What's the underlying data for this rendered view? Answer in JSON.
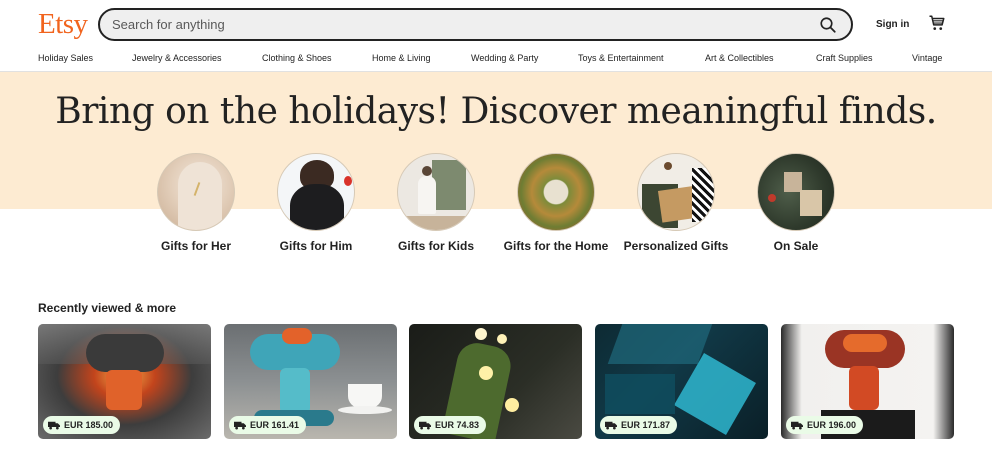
{
  "header": {
    "logo": "Etsy",
    "search_placeholder": "Search for anything",
    "sign_in": "Sign in",
    "brand_color": "#F1641E"
  },
  "nav": {
    "items": [
      {
        "label": "Holiday Sales"
      },
      {
        "label": "Jewelry & Accessories"
      },
      {
        "label": "Clothing & Shoes"
      },
      {
        "label": "Home & Living"
      },
      {
        "label": "Wedding & Party"
      },
      {
        "label": "Toys & Entertainment"
      },
      {
        "label": "Art & Collectibles"
      },
      {
        "label": "Craft Supplies"
      },
      {
        "label": "Vintage"
      }
    ]
  },
  "hero": {
    "title": "Bring on the holidays! Discover meaningful finds.",
    "background": "#FDEBD2"
  },
  "categories": [
    {
      "label": "Gifts for Her"
    },
    {
      "label": "Gifts for Him"
    },
    {
      "label": "Gifts for Kids"
    },
    {
      "label": "Gifts for the Home"
    },
    {
      "label": "Personalized Gifts"
    },
    {
      "label": "On Sale"
    }
  ],
  "recently_viewed": {
    "title": "Recently viewed & more",
    "items": [
      {
        "price": "EUR 185.00",
        "icon": "free-shipping-truck-icon"
      },
      {
        "price": "EUR 161.41",
        "icon": "free-shipping-truck-icon"
      },
      {
        "price": "EUR 74.83",
        "icon": "free-shipping-truck-icon"
      },
      {
        "price": "EUR 171.87",
        "icon": "free-shipping-truck-icon"
      },
      {
        "price": "EUR 196.00",
        "icon": "free-shipping-truck-icon"
      }
    ]
  }
}
